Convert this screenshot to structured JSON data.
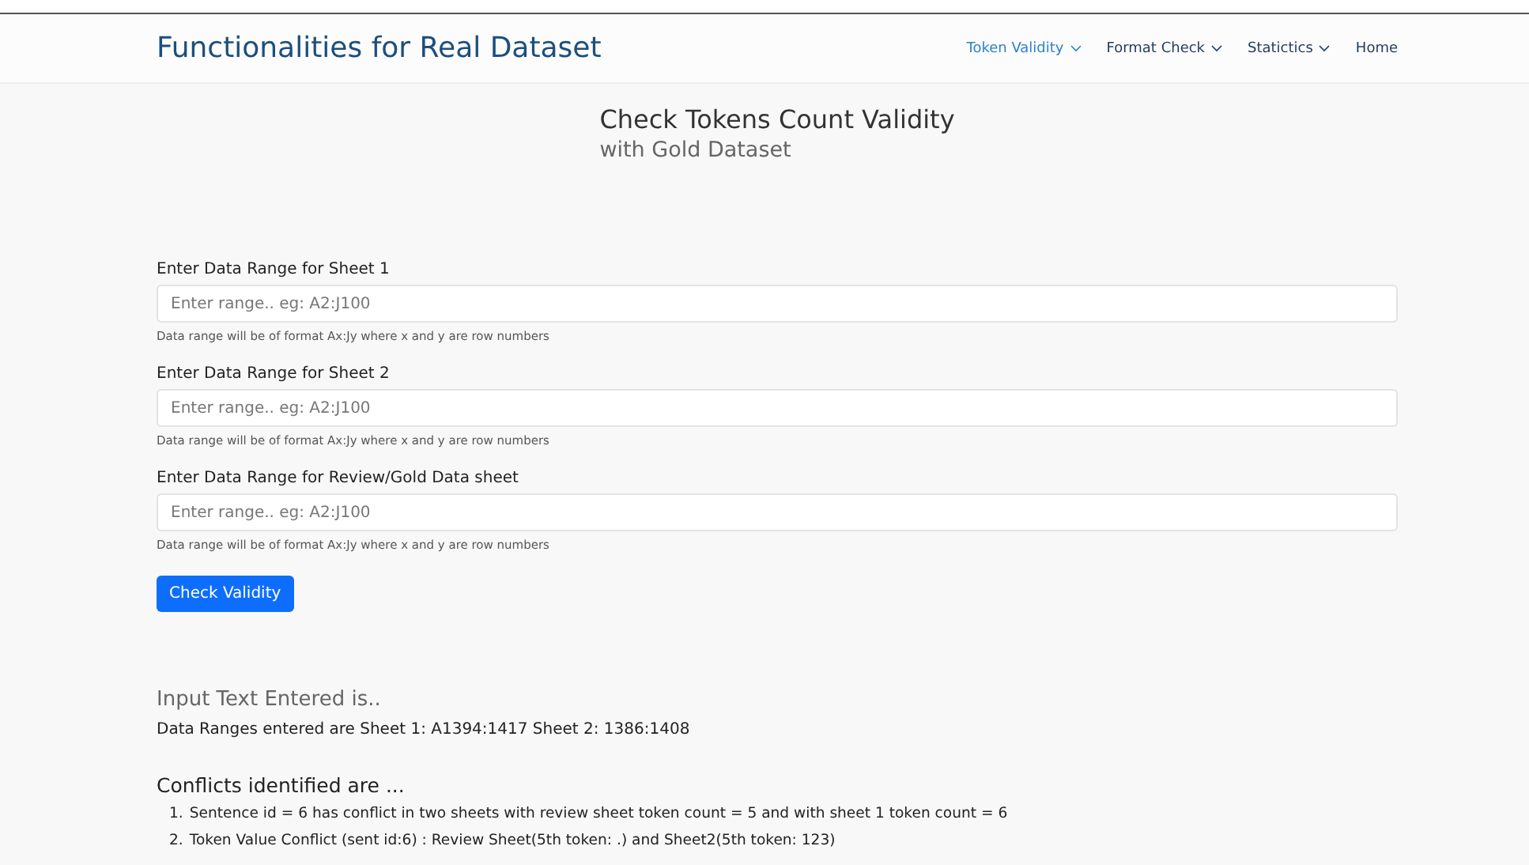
{
  "navbar": {
    "brand": "Functionalities for Real Dataset",
    "items": [
      {
        "label": "Token Validity",
        "dropdown": true,
        "selected": true
      },
      {
        "label": "Format Check",
        "dropdown": true,
        "selected": false
      },
      {
        "label": "Statictics",
        "dropdown": true,
        "selected": false
      },
      {
        "label": "Home",
        "dropdown": false,
        "selected": false
      }
    ]
  },
  "heading": {
    "title": "Check Tokens Count Validity",
    "subtitle": "with Gold Dataset"
  },
  "form": {
    "fields": [
      {
        "label": "Enter Data Range for Sheet 1",
        "placeholder": "Enter range.. eg: A2:J100",
        "help": "Data range will be of format Ax:Jy where x and y are row numbers"
      },
      {
        "label": "Enter Data Range for Sheet 2",
        "placeholder": "Enter range.. eg: A2:J100",
        "help": "Data range will be of format Ax:Jy where x and y are row numbers"
      },
      {
        "label": "Enter Data Range for Review/Gold Data sheet",
        "placeholder": "Enter range.. eg: A2:J100",
        "help": "Data range will be of format Ax:Jy where x and y are row numbers"
      }
    ],
    "button": "Check Validity"
  },
  "input_section": {
    "title": "Input Text Entered is..",
    "text": "Data Ranges entered are Sheet 1: A1394:1417 Sheet 2: 1386:1408"
  },
  "conflicts": {
    "title": "Conflicts identified are ...",
    "items": [
      {
        "number": "1.",
        "text": "Sentence id = 6 has conflict in two sheets with review sheet token count = 5 and with sheet 1 token count = 6"
      },
      {
        "number": "2.",
        "text": "Token Value Conflict (sent id:6) : Review Sheet(5th token: .) and Sheet2(5th token: 123)"
      }
    ]
  }
}
